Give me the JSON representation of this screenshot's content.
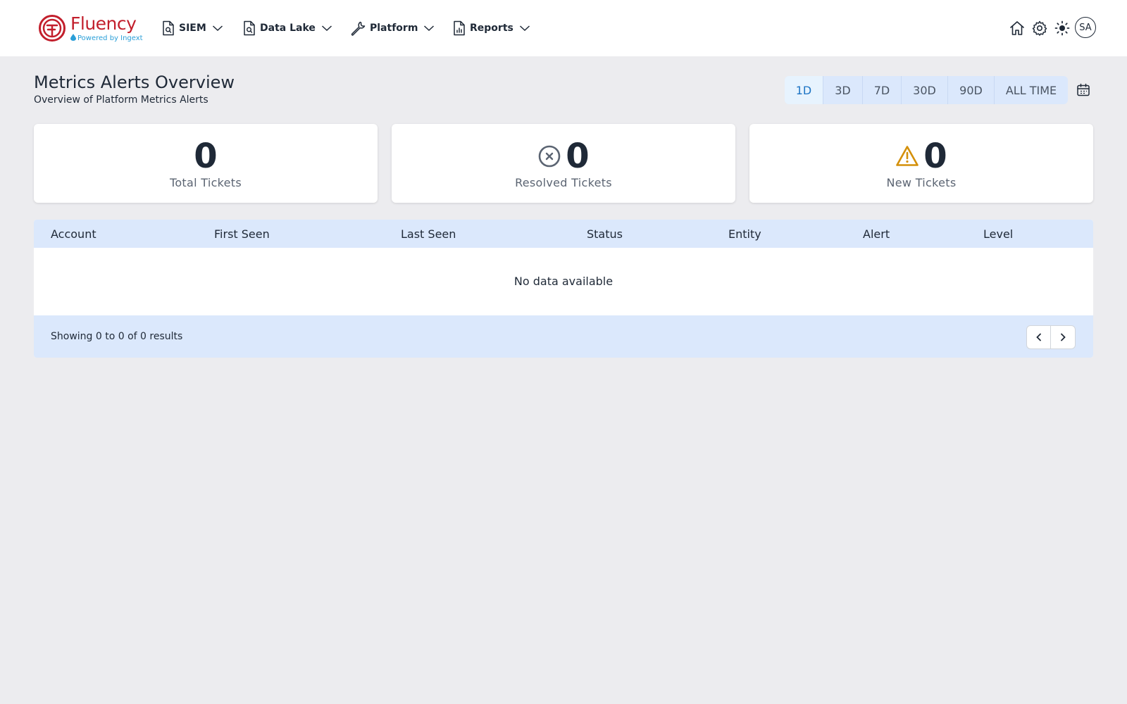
{
  "brand": {
    "name": "Fluency",
    "tagline": "Powered by Ingext",
    "primary_color": "#c21f2c",
    "accent_color": "#2b9fd8"
  },
  "nav": [
    {
      "label": "SIEM",
      "icon": "document-search-icon"
    },
    {
      "label": "Data Lake",
      "icon": "document-search-icon"
    },
    {
      "label": "Platform",
      "icon": "wrench-icon"
    },
    {
      "label": "Reports",
      "icon": "chart-document-icon"
    }
  ],
  "header_icons": [
    "home-icon",
    "gear-icon",
    "sun-icon"
  ],
  "user": {
    "initials": "SA"
  },
  "page": {
    "title": "Metrics Alerts Overview",
    "subtitle": "Overview of Platform Metrics Alerts"
  },
  "ranges": {
    "options": [
      "1D",
      "3D",
      "7D",
      "30D",
      "90D",
      "ALL TIME"
    ],
    "selected": "1D"
  },
  "stats": {
    "total": {
      "value": "0",
      "label": "Total Tickets"
    },
    "resolved": {
      "value": "0",
      "label": "Resolved Tickets",
      "icon": "x-circle-icon"
    },
    "new": {
      "value": "0",
      "label": "New Tickets",
      "icon": "warning-icon",
      "icon_color": "#d4900a"
    }
  },
  "table": {
    "columns": [
      "Account",
      "First Seen",
      "Last Seen",
      "Status",
      "Entity",
      "Alert",
      "Level"
    ],
    "rows": [],
    "empty_text": "No data available",
    "footer": "Showing 0 to 0 of 0 results"
  }
}
